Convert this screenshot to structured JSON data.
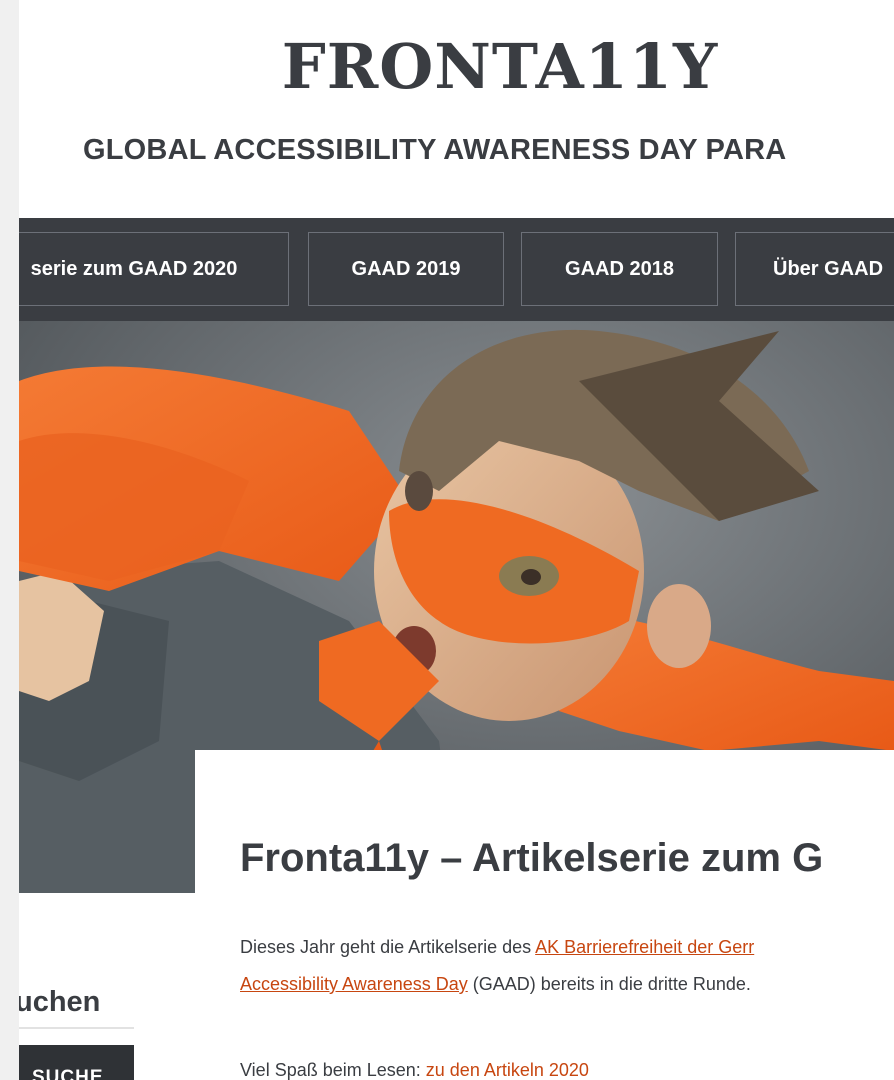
{
  "header": {
    "site_title": "FRONTA11Y",
    "tagline": "GLOBAL ACCESSIBILITY AWARENESS DAY PARA"
  },
  "nav": {
    "items": [
      {
        "label": "serie zum GAAD 2020"
      },
      {
        "label": "GAAD 2019"
      },
      {
        "label": "GAAD 2018"
      },
      {
        "label": "Über GAAD"
      }
    ]
  },
  "hero": {
    "description": "Child in orange superhero mask and cape"
  },
  "post": {
    "title": "Fronta11y – Artikelserie zum G",
    "intro_prefix": "Dieses Jahr geht die Artikelserie des ",
    "intro_link1": "AK Barrierefreiheit der Gerr",
    "intro_link2": "Accessibility Awareness Day",
    "intro_suffix": " (GAAD) bereits in die dritte Runde.",
    "reading_prefix": "Viel Spaß beim Lesen: ",
    "reading_link": "zu den Artikeln 2020"
  },
  "sidebar": {
    "widget_title": "uchen",
    "search_button": "SUCHE"
  },
  "colors": {
    "nav_bg": "#3a3d42",
    "link": "#c74610",
    "cape": "#f06a24",
    "text": "#3a3d42"
  }
}
